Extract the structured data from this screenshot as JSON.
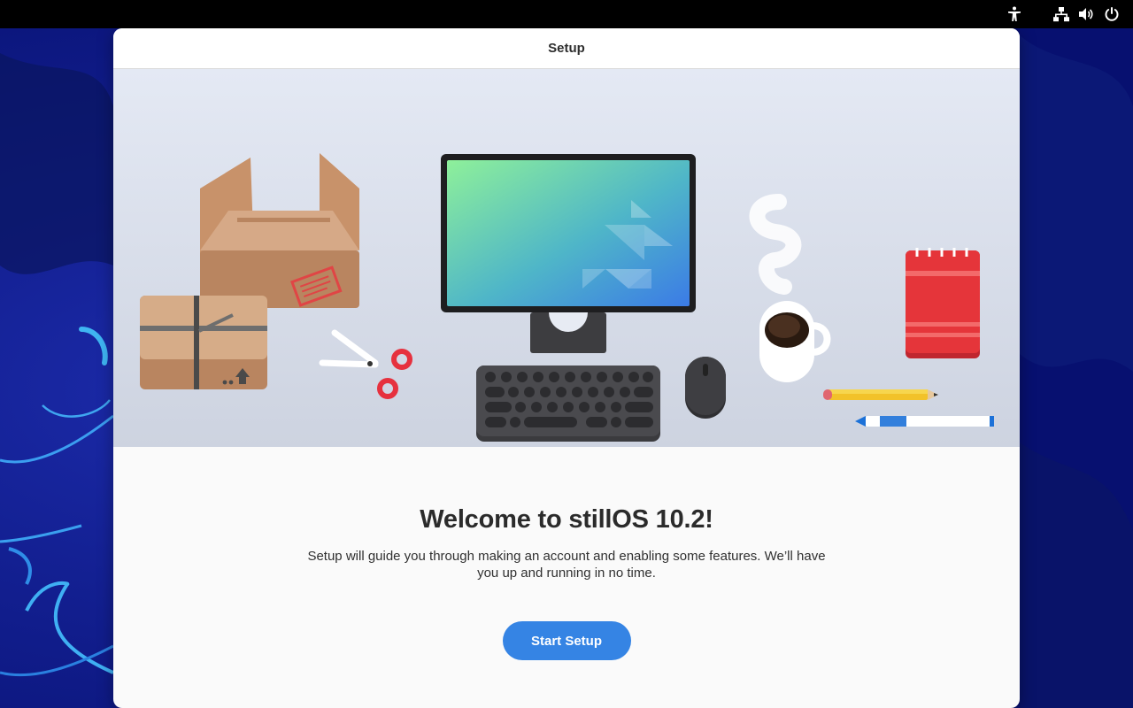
{
  "window": {
    "title": "Setup"
  },
  "welcome": {
    "title": "Welcome to stillOS 10.2!",
    "description": "Setup will guide you through making an account and enabling some features. We’ll have you up and running in no time.",
    "start_button_label": "Start Setup"
  },
  "top_bar": {
    "icons": [
      "accessibility-icon",
      "network-icon",
      "volume-icon",
      "power-icon"
    ]
  },
  "colors": {
    "accent": "#3584e4",
    "top_bar": "#000000",
    "wallpaper": "#0c1a86"
  }
}
